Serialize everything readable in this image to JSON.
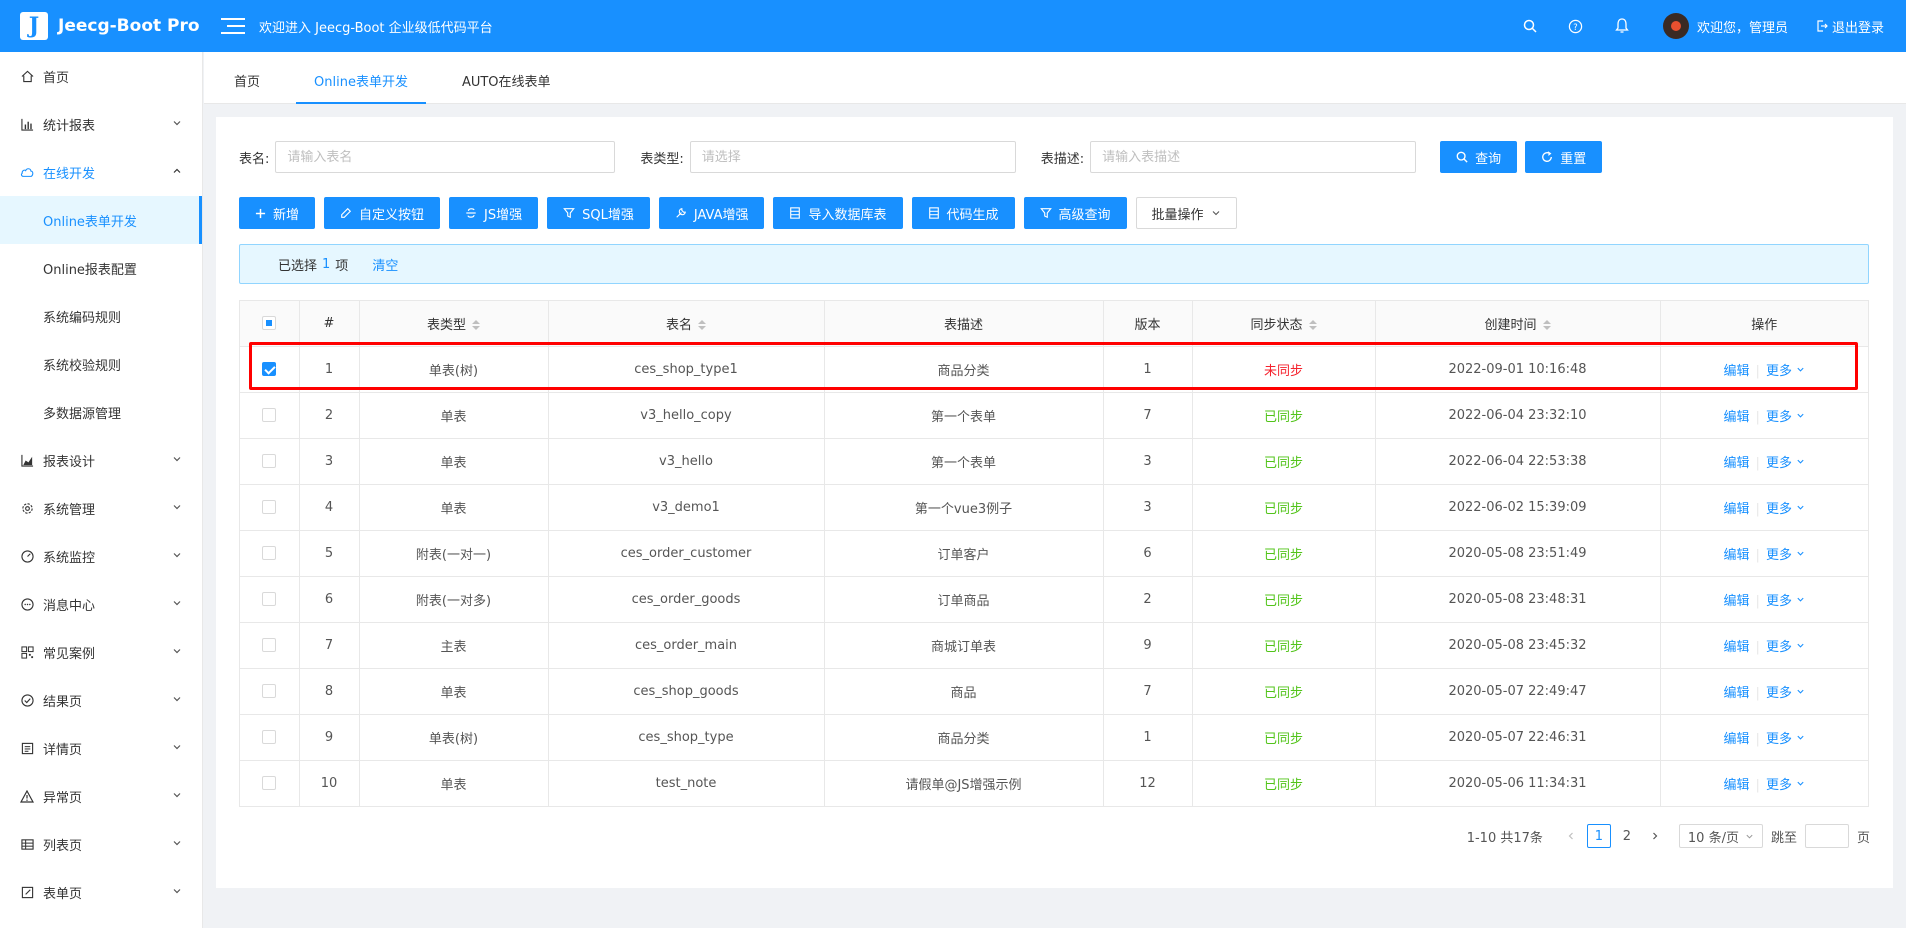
{
  "header": {
    "logo_letter": "J",
    "app_name": "Jeecg-Boot Pro",
    "welcome_title": "欢迎进入 Jeecg-Boot 企业级低代码平台",
    "user_text": "欢迎您，管理员",
    "logout_label": "退出登录",
    "icons": [
      "search-icon",
      "help-icon",
      "bell-icon"
    ]
  },
  "sidebar": {
    "items": [
      {
        "label": "首页",
        "icon": "home-icon"
      },
      {
        "label": "统计报表",
        "icon": "bar-chart-icon"
      },
      {
        "label": "在线开发",
        "icon": "cloud-icon"
      },
      {
        "label": "报表设计",
        "icon": "area-chart-icon"
      },
      {
        "label": "系统管理",
        "icon": "gear-icon"
      },
      {
        "label": "系统监控",
        "icon": "dashboard-icon"
      },
      {
        "label": "消息中心",
        "icon": "message-icon"
      },
      {
        "label": "常见案例",
        "icon": "qrcode-icon"
      },
      {
        "label": "结果页",
        "icon": "check-circle-icon"
      },
      {
        "label": "详情页",
        "icon": "profile-icon"
      },
      {
        "label": "异常页",
        "icon": "warning-icon"
      },
      {
        "label": "列表页",
        "icon": "table-icon"
      },
      {
        "label": "表单页",
        "icon": "form-icon"
      }
    ],
    "sub_items": [
      "Online表单开发",
      "Online报表配置",
      "系统编码规则",
      "系统校验规则",
      "多数据源管理"
    ]
  },
  "tabs": [
    "首页",
    "Online表单开发",
    "AUTO在线表单"
  ],
  "search": {
    "name_label": "表名:",
    "name_placeholder": "请输入表名",
    "type_label": "表类型:",
    "type_placeholder": "请选择",
    "desc_label": "表描述:",
    "desc_placeholder": "请输入表描述",
    "query_label": "查询",
    "reset_label": "重置"
  },
  "toolbar": {
    "add": "新增",
    "custom_button": "自定义按钮",
    "js": "JS增强",
    "sql": "SQL增强",
    "java": "JAVA增强",
    "import_db": "导入数据库表",
    "codegen": "代码生成",
    "advanced_query": "高级查询",
    "batch": "批量操作"
  },
  "selection": {
    "prefix": "已选择",
    "count": "1",
    "suffix": "项",
    "clear": "清空"
  },
  "table": {
    "headers": [
      "#",
      "表类型",
      "表名",
      "表描述",
      "版本",
      "同步状态",
      "创建时间",
      "操作"
    ],
    "edit_label": "编辑",
    "more_label": "更多",
    "rows": [
      {
        "no": "1",
        "type": "单表(树)",
        "name": "ces_shop_type1",
        "desc": "商品分类",
        "version": "1",
        "status": "未同步",
        "synced": false,
        "created": "2022-09-01 10:16:48",
        "checked": true
      },
      {
        "no": "2",
        "type": "单表",
        "name": "v3_hello_copy",
        "desc": "第一个表单",
        "version": "7",
        "status": "已同步",
        "synced": true,
        "created": "2022-06-04 23:32:10",
        "checked": false
      },
      {
        "no": "3",
        "type": "单表",
        "name": "v3_hello",
        "desc": "第一个表单",
        "version": "3",
        "status": "已同步",
        "synced": true,
        "created": "2022-06-04 22:53:38",
        "checked": false
      },
      {
        "no": "4",
        "type": "单表",
        "name": "v3_demo1",
        "desc": "第一个vue3例子",
        "version": "3",
        "status": "已同步",
        "synced": true,
        "created": "2022-06-02 15:39:09",
        "checked": false
      },
      {
        "no": "5",
        "type": "附表(一对一)",
        "name": "ces_order_customer",
        "desc": "订单客户",
        "version": "6",
        "status": "已同步",
        "synced": true,
        "created": "2020-05-08 23:51:49",
        "checked": false
      },
      {
        "no": "6",
        "type": "附表(一对多)",
        "name": "ces_order_goods",
        "desc": "订单商品",
        "version": "2",
        "status": "已同步",
        "synced": true,
        "created": "2020-05-08 23:48:31",
        "checked": false
      },
      {
        "no": "7",
        "type": "主表",
        "name": "ces_order_main",
        "desc": "商城订单表",
        "version": "9",
        "status": "已同步",
        "synced": true,
        "created": "2020-05-08 23:45:32",
        "checked": false
      },
      {
        "no": "8",
        "type": "单表",
        "name": "ces_shop_goods",
        "desc": "商品",
        "version": "7",
        "status": "已同步",
        "synced": true,
        "created": "2020-05-07 22:49:47",
        "checked": false
      },
      {
        "no": "9",
        "type": "单表(树)",
        "name": "ces_shop_type",
        "desc": "商品分类",
        "version": "1",
        "status": "已同步",
        "synced": true,
        "created": "2020-05-07 22:46:31",
        "checked": false
      },
      {
        "no": "10",
        "type": "单表",
        "name": "test_note",
        "desc": "请假单@JS增强示例",
        "version": "12",
        "status": "已同步",
        "synced": true,
        "created": "2020-05-06 11:34:31",
        "checked": false
      }
    ]
  },
  "pagination": {
    "total": "1-10 共17条",
    "pages": [
      "1",
      "2"
    ],
    "current": "1",
    "page_size": "10 条/页",
    "goto_label": "跳至",
    "page_suffix": "页"
  },
  "colors": {
    "primary": "#1890ff",
    "synced": "#52c41a",
    "unsynced": "#f5222d",
    "highlight": "#ff0000"
  }
}
